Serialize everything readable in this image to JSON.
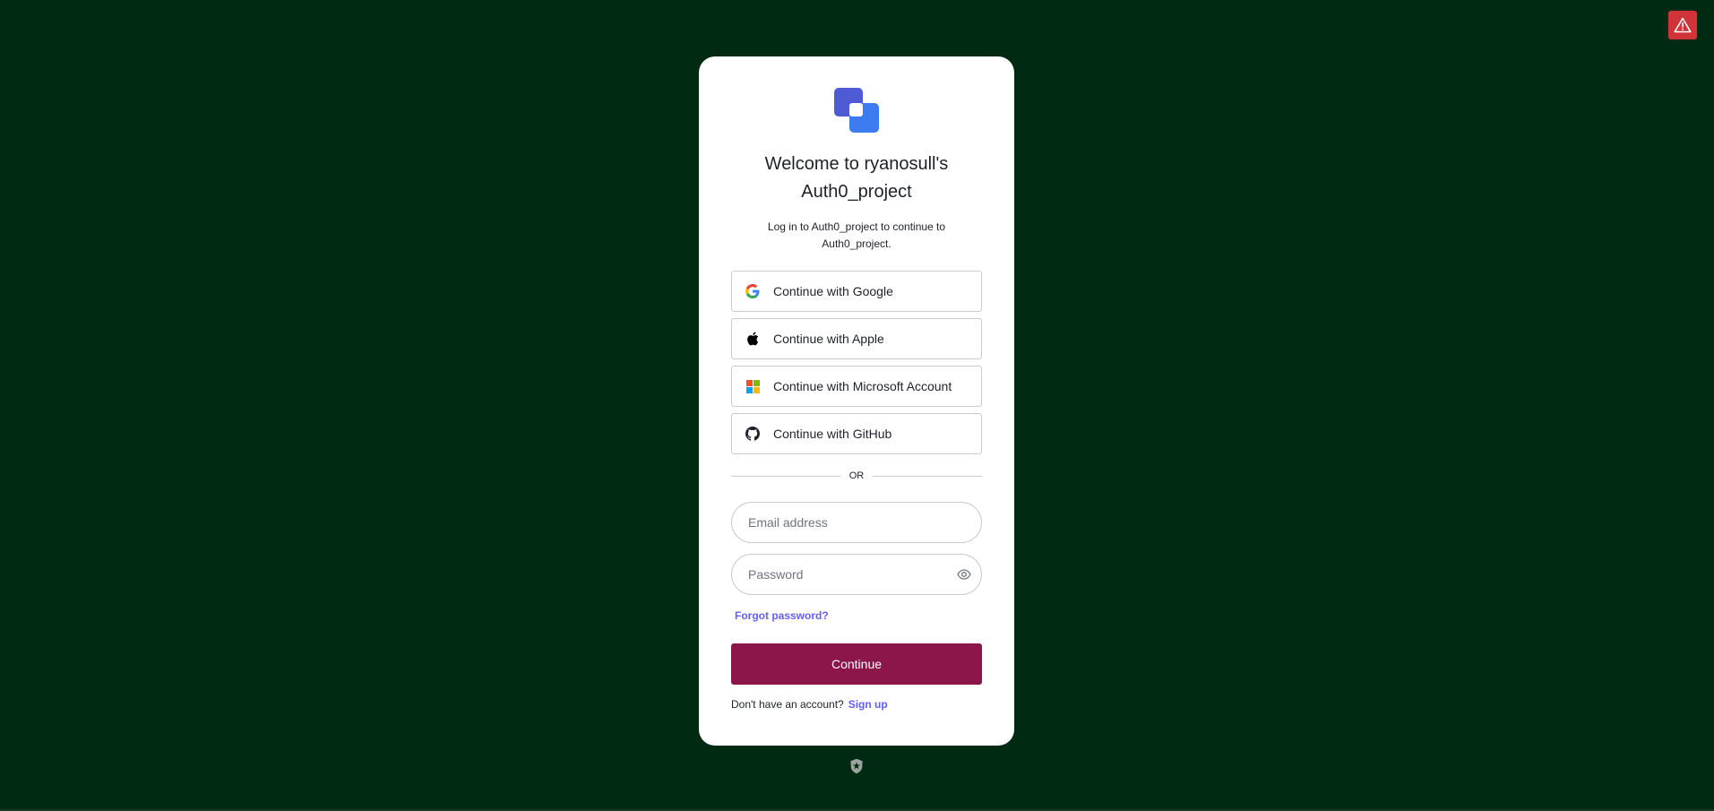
{
  "header": {
    "warning_icon": "warning-triangle-icon",
    "warning_color": "#d13438"
  },
  "login": {
    "logo_icon": "overlapping-squares-logo",
    "title_line1": "Welcome to ryanosull's",
    "title_line2": "Auth0_project",
    "subtitle_line1": "Log in to Auth0_project to continue to",
    "subtitle_line2": "Auth0_project.",
    "social": [
      {
        "label": "Continue with Google",
        "icon": "google-icon"
      },
      {
        "label": "Continue with Apple",
        "icon": "apple-icon"
      },
      {
        "label": "Continue with Microsoft Account",
        "icon": "microsoft-icon"
      },
      {
        "label": "Continue with GitHub",
        "icon": "github-icon"
      }
    ],
    "divider_text": "OR",
    "email": {
      "value": "",
      "placeholder": "Email address"
    },
    "password": {
      "value": "",
      "placeholder": "Password",
      "toggle_icon": "eye-icon"
    },
    "forgot_label": "Forgot password?",
    "continue_label": "Continue",
    "signup_prompt": "Don't have an account?",
    "signup_label": "Sign up"
  },
  "footer": {
    "icon": "auth0-shield-icon"
  },
  "colors": {
    "background": "#002a12",
    "card": "#ffffff",
    "primary_button": "#8c1549",
    "link": "#635dff",
    "logo_primary": "#4f5bd5",
    "logo_secondary": "#3c7bf0"
  }
}
